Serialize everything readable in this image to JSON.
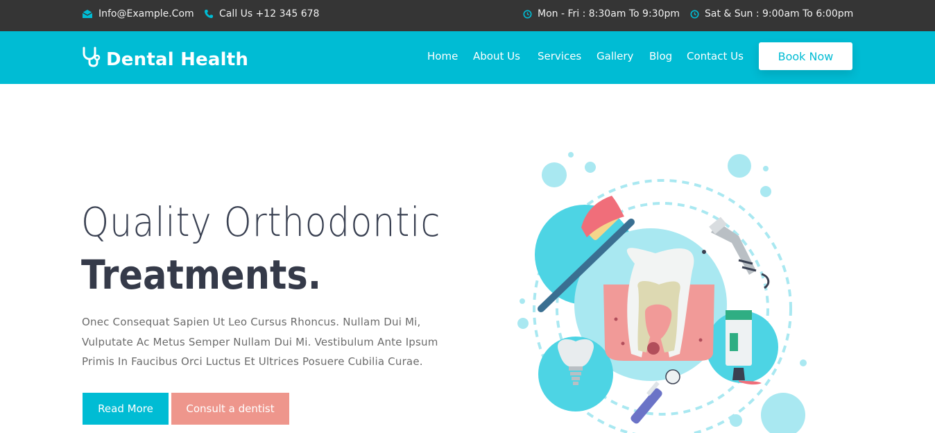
{
  "topbar": {
    "email": "Info@Example.Com",
    "phone": "Call Us +12 345 678",
    "weekday_hours": "Mon - Fri : 8:30am To 9:30pm",
    "weekend_hours": "Sat & Sun : 9:00am To 6:00pm"
  },
  "brand": {
    "name": "Dental Health"
  },
  "nav": {
    "items": [
      "Home",
      "About Us",
      "Services",
      "Gallery",
      "Blog",
      "Contact Us"
    ],
    "cta": "Book Now"
  },
  "hero": {
    "title_line1": "Quality Orthodontic",
    "title_line2": "Treatments.",
    "description": "Onec Consequat Sapien Ut Leo Cursus Rhoncus. Nullam Dui Mi, Vulputate Ac Metus Semper Nullam Dui Mi. Vestibulum Ante Ipsum Primis In Faucibus Orci Luctus Et Ultrices Posuere Cubilia Curae.",
    "primary_button": "Read More",
    "secondary_button": "Consult a dentist"
  },
  "colors": {
    "accent": "#00bcd4",
    "topbar_bg": "#353535",
    "secondary_button": "#ee968c",
    "heading": "#353a49"
  },
  "icons": {
    "email": "envelope-icon",
    "phone": "phone-icon",
    "clock": "clock-icon",
    "brand": "stethoscope-icon"
  }
}
